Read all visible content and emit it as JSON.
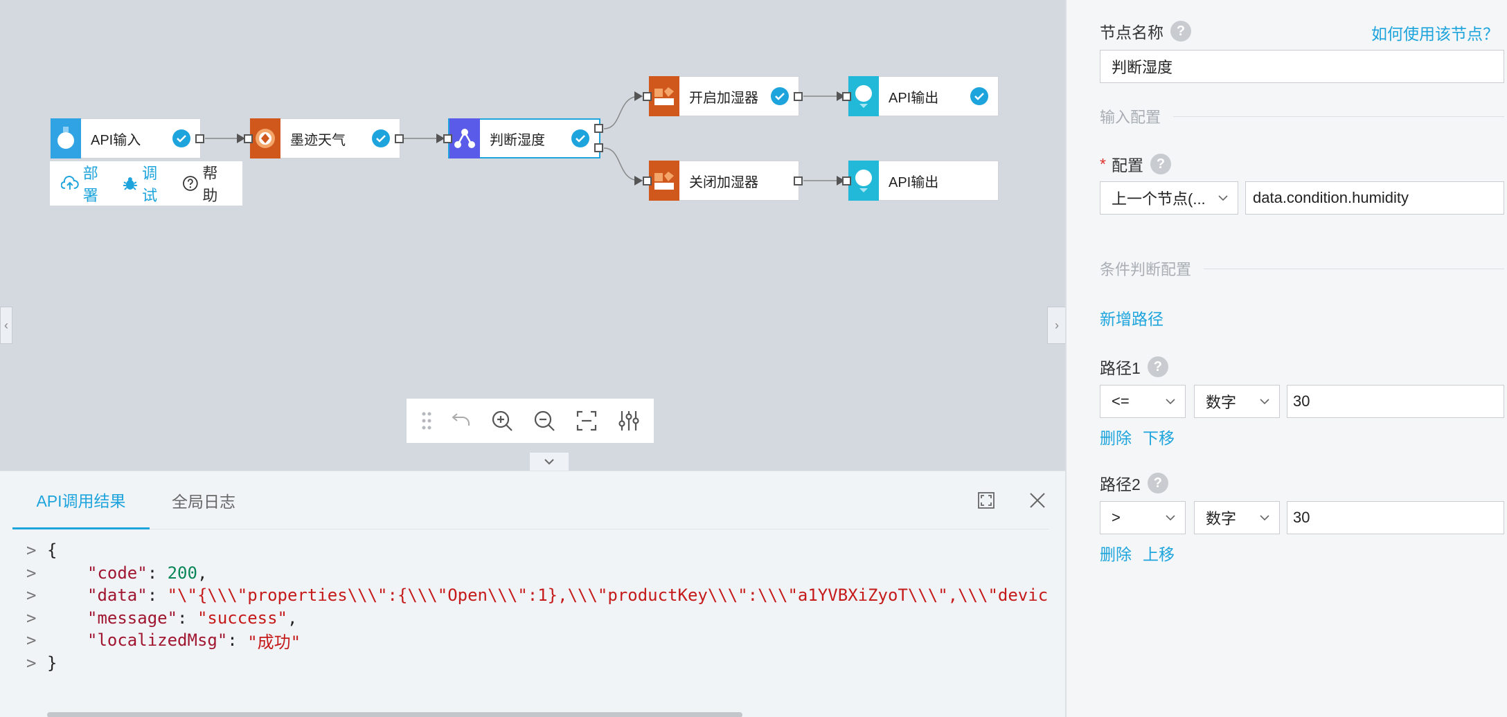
{
  "canvas": {
    "nodes": {
      "api_input": {
        "label": "API输入"
      },
      "moji_weather": {
        "label": "墨迹天气"
      },
      "judge_humidity": {
        "label": "判断湿度"
      },
      "open_humidifier": {
        "label": "开启加湿器"
      },
      "api_output_1": {
        "label": "API输出"
      },
      "close_humidifier": {
        "label": "关闭加湿器"
      },
      "api_output_2": {
        "label": "API输出"
      }
    },
    "actions": {
      "deploy": "部署",
      "debug": "调试",
      "help": "帮助"
    },
    "colors": {
      "blue_node": "#2fa3e3",
      "orange_node": "#d1581d",
      "purple_node": "#5a5be8",
      "cyan_node": "#22b8d8",
      "accent": "#1ea4dc"
    }
  },
  "bottom_panel": {
    "tabs": [
      "API调用结果",
      "全局日志"
    ],
    "code_lines": [
      {
        "gutter": ">",
        "text": "{"
      },
      {
        "gutter": ">",
        "key": "\"code\"",
        "sep": ": ",
        "value": "200",
        "end": ","
      },
      {
        "gutter": ">",
        "key": "\"data\"",
        "sep": ": ",
        "value": "\"\\\"{\\\\\\\"properties\\\\\\\":{\\\\\\\"Open\\\\\\\":1},\\\\\\\"productKey\\\\\\\":\\\\\\\"a1YVBXiZyoT\\\\\\\",\\\\\\\"devic",
        "end": ""
      },
      {
        "gutter": ">",
        "key": "\"message\"",
        "sep": ": ",
        "value": "\"success\"",
        "end": ","
      },
      {
        "gutter": ">",
        "key": "\"localizedMsg\"",
        "sep": ": ",
        "value": "\"成功\"",
        "end": ""
      },
      {
        "gutter": ">",
        "text": "}"
      }
    ]
  },
  "right_panel": {
    "node_name_label": "节点名称",
    "help_link": "如何使用该节点？",
    "node_name_value": "判断湿度",
    "input_config_section": "输入配置",
    "config_label": "配置",
    "config_source": "上一个节点(...",
    "config_path": "data.condition.humidity",
    "condition_section": "条件判断配置",
    "add_path": "新增路径",
    "paths": [
      {
        "label": "路径1",
        "operator": "<=",
        "type": "数字",
        "value": "30",
        "delete": "删除",
        "move": "下移"
      },
      {
        "label": "路径2",
        "operator": ">",
        "type": "数字",
        "value": "30",
        "delete": "删除",
        "move": "上移"
      }
    ]
  }
}
